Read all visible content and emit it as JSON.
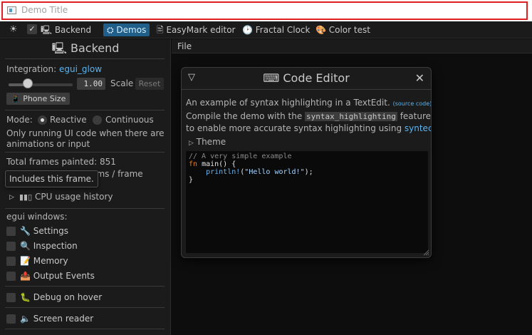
{
  "window": {
    "title": "Demo Title"
  },
  "topbar": {
    "theme_icon": "sun-icon",
    "backend_checked": true,
    "backend_label": "🖳 Backend",
    "items": [
      {
        "label": "⛭ Demos",
        "selected": true
      },
      {
        "label": "🖹 EasyMark editor",
        "selected": false
      },
      {
        "label": "🕑 Fractal Clock",
        "selected": false
      },
      {
        "label": "🎨 Color test",
        "selected": false
      }
    ]
  },
  "backend_panel": {
    "heading": "🖳 Backend",
    "integration_label": "Integration: ",
    "integration_link": "egui_glow",
    "scale_value": "1.00",
    "scale_label": "Scale",
    "reset_label": "Reset",
    "phone_size_label": "📱 Phone Size",
    "mode_label": "Mode:",
    "mode_options": [
      "Reactive",
      "Continuous"
    ],
    "mode_selected": "Reactive",
    "mode_note_line1": "Only running UI code when there are",
    "mode_note_line2": "animations or input",
    "total_frames": "Total frames painted: 851",
    "frame_time_suffix": "3 ms / frame",
    "tooltip": "Includes this frame.",
    "cpu_history_label": "CPU usage history",
    "windows_heading": "egui windows:",
    "windows": [
      {
        "label": "🔧 Settings",
        "checked": false
      },
      {
        "label": "🔍 Inspection",
        "checked": false
      },
      {
        "label": "📝 Memory",
        "checked": false
      },
      {
        "label": "📤 Output Events",
        "checked": false
      }
    ],
    "debug_on_hover": "🐛 Debug on hover",
    "screen_reader": "🔈 Screen reader"
  },
  "central": {
    "file_menu": "File"
  },
  "code_editor": {
    "title": "⌨ Code Editor",
    "intro": "An example of syntax highlighting in a TextEdit.",
    "source_link": "(source code)",
    "compile_pre": "Compile the demo with the ",
    "compile_code": "syntax_highlighting",
    "compile_post": " feature",
    "enable_pre": "to enable more accurate syntax highlighting using ",
    "enable_link": "syntect",
    "enable_post": ".",
    "theme_label": "Theme",
    "code": {
      "line1": "// A very simple example",
      "line2_kw": "fn",
      "line2_rest": " main() {",
      "line3_indent": "    ",
      "line3_macro": "println!",
      "line3_open": "(",
      "line3_str": "\"Hello world!\"",
      "line3_close": ");",
      "line4": "}"
    }
  }
}
